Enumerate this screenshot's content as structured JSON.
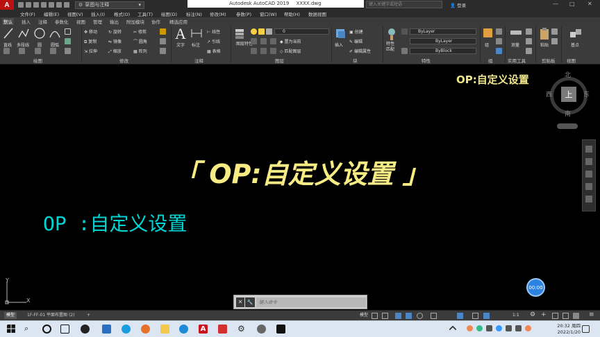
{
  "titlebar": {
    "app_logo": "A",
    "workspace": "草图与注释",
    "app_title": "Autodesk AutoCAD 2019",
    "file_name": "XXXX.dwg",
    "search_placeholder": "键入关键字或短语",
    "login": "登录"
  },
  "menubar": [
    "文件(F)",
    "编辑(E)",
    "视图(V)",
    "插入(I)",
    "格式(O)",
    "工具(T)",
    "绘图(D)",
    "标注(N)",
    "修改(M)",
    "参数(P)",
    "窗口(W)",
    "帮助(H)",
    "数据视图"
  ],
  "ribbon_tabs": [
    "默认",
    "插入",
    "注释",
    "参数化",
    "视图",
    "管理",
    "输出",
    "附加模块",
    "协作",
    "精选应用"
  ],
  "ribbon": {
    "draw": {
      "title": "绘图",
      "line": "直线",
      "polyline": "多段线",
      "circle": "圆",
      "arc": "圆弧"
    },
    "modify": {
      "title": "修改",
      "move": "移动",
      "rotate": "旋转",
      "trim": "修剪",
      "copy": "复制",
      "mirror": "镜像",
      "fillet": "圆角",
      "stretch": "拉伸",
      "scale": "缩放",
      "array": "阵列"
    },
    "annotation": {
      "title": "注释",
      "text": "文字",
      "dimension": "标注",
      "linear": "线性",
      "leader": "引线",
      "table": "表格"
    },
    "layers": {
      "title": "图层",
      "layer_props": "图层特性",
      "current_layer": "0",
      "make_current": "置为当前",
      "match_layer": "匹配图层"
    },
    "block": {
      "title": "块",
      "insert": "插入",
      "create": "创建",
      "edit": "编辑",
      "edit_attr": "编辑属性"
    },
    "properties": {
      "title": "特性",
      "match": "特性匹配",
      "color": "ByLayer",
      "linetype": "ByLayer",
      "lineweight": "ByBlock"
    },
    "groups": {
      "title": "组",
      "group": "组"
    },
    "utilities": {
      "title": "实用工具",
      "measure": "测量"
    },
    "clipboard": {
      "title": "剪贴板",
      "paste": "粘贴"
    },
    "view": {
      "title": "视图",
      "base": "基点"
    }
  },
  "canvas": {
    "corner_title": "OP:自定义设置",
    "center_title": "「 OP:自定义设置 」",
    "cyan_text": "OP :自定义设置",
    "viewcube": {
      "north": "北",
      "south": "南",
      "east": "东",
      "west": "西",
      "top": "上"
    },
    "ucs": {
      "x": "X",
      "y": "Y"
    },
    "timer": "00:00"
  },
  "commandline": {
    "prompt": "键入命令"
  },
  "statusbar": {
    "tabs": [
      "模型",
      "1F-FF-01 平面布置图 (2)"
    ],
    "add": "+",
    "model_label": "模型",
    "scale": "1:1"
  },
  "taskbar": {
    "time": "20:32 周四",
    "date": "2022/1/20"
  },
  "colors": {
    "canvas_bg": "#000000",
    "title_yellow": "#f7ec83",
    "cyan_text": "#00d5d5",
    "ribbon_bg": "#3b3b3b",
    "timer_blue": "#2b82e0"
  }
}
